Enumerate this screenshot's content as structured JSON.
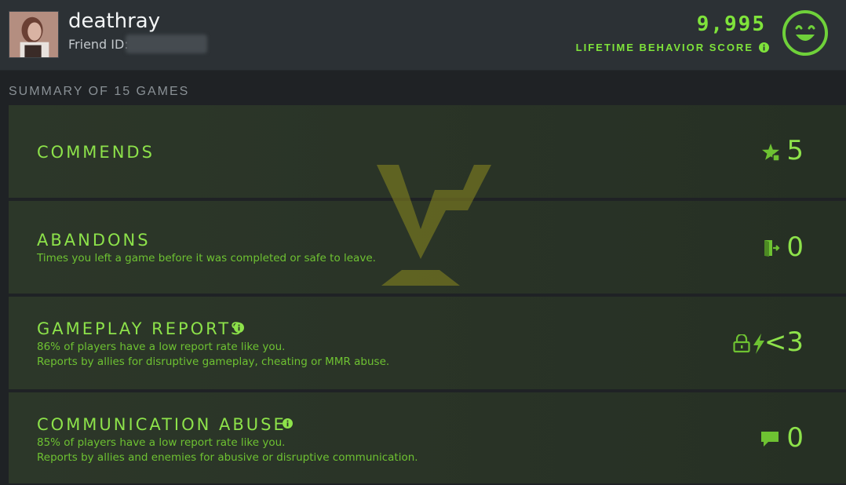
{
  "profile": {
    "username": "deathray",
    "friend_id_label": "Friend ID:"
  },
  "behavior": {
    "score": "9,995",
    "label": "LIFETIME BEHAVIOR SCORE"
  },
  "summary": {
    "title": "SUMMARY OF 15 GAMES"
  },
  "stats": {
    "commends": {
      "title": "COMMENDS",
      "value": "5",
      "icon": "star-commend-icon"
    },
    "abandons": {
      "title": "ABANDONS",
      "desc": "Times you left a game before it was completed or safe to leave.",
      "value": "0",
      "icon": "door-exit-icon"
    },
    "gameplay_reports": {
      "title": "GAMEPLAY REPORTS",
      "desc1": "86% of players have a low report rate like you.",
      "desc2": "Reports by allies for disruptive gameplay, cheating or MMR abuse.",
      "value": "<3",
      "icons": [
        "lock-icon",
        "lightning-icon"
      ]
    },
    "communication_abuse": {
      "title": "COMMUNICATION ABUSE",
      "desc1": "85% of players have a low report rate like you.",
      "desc2": "Reports by allies and enemies for abusive or disruptive communication.",
      "value": "0",
      "icon": "chat-bubble-icon"
    }
  },
  "colors": {
    "accent": "#8de24a",
    "score_green": "#7fe33b",
    "background": "#1f2225",
    "panel": "#2a3427"
  }
}
